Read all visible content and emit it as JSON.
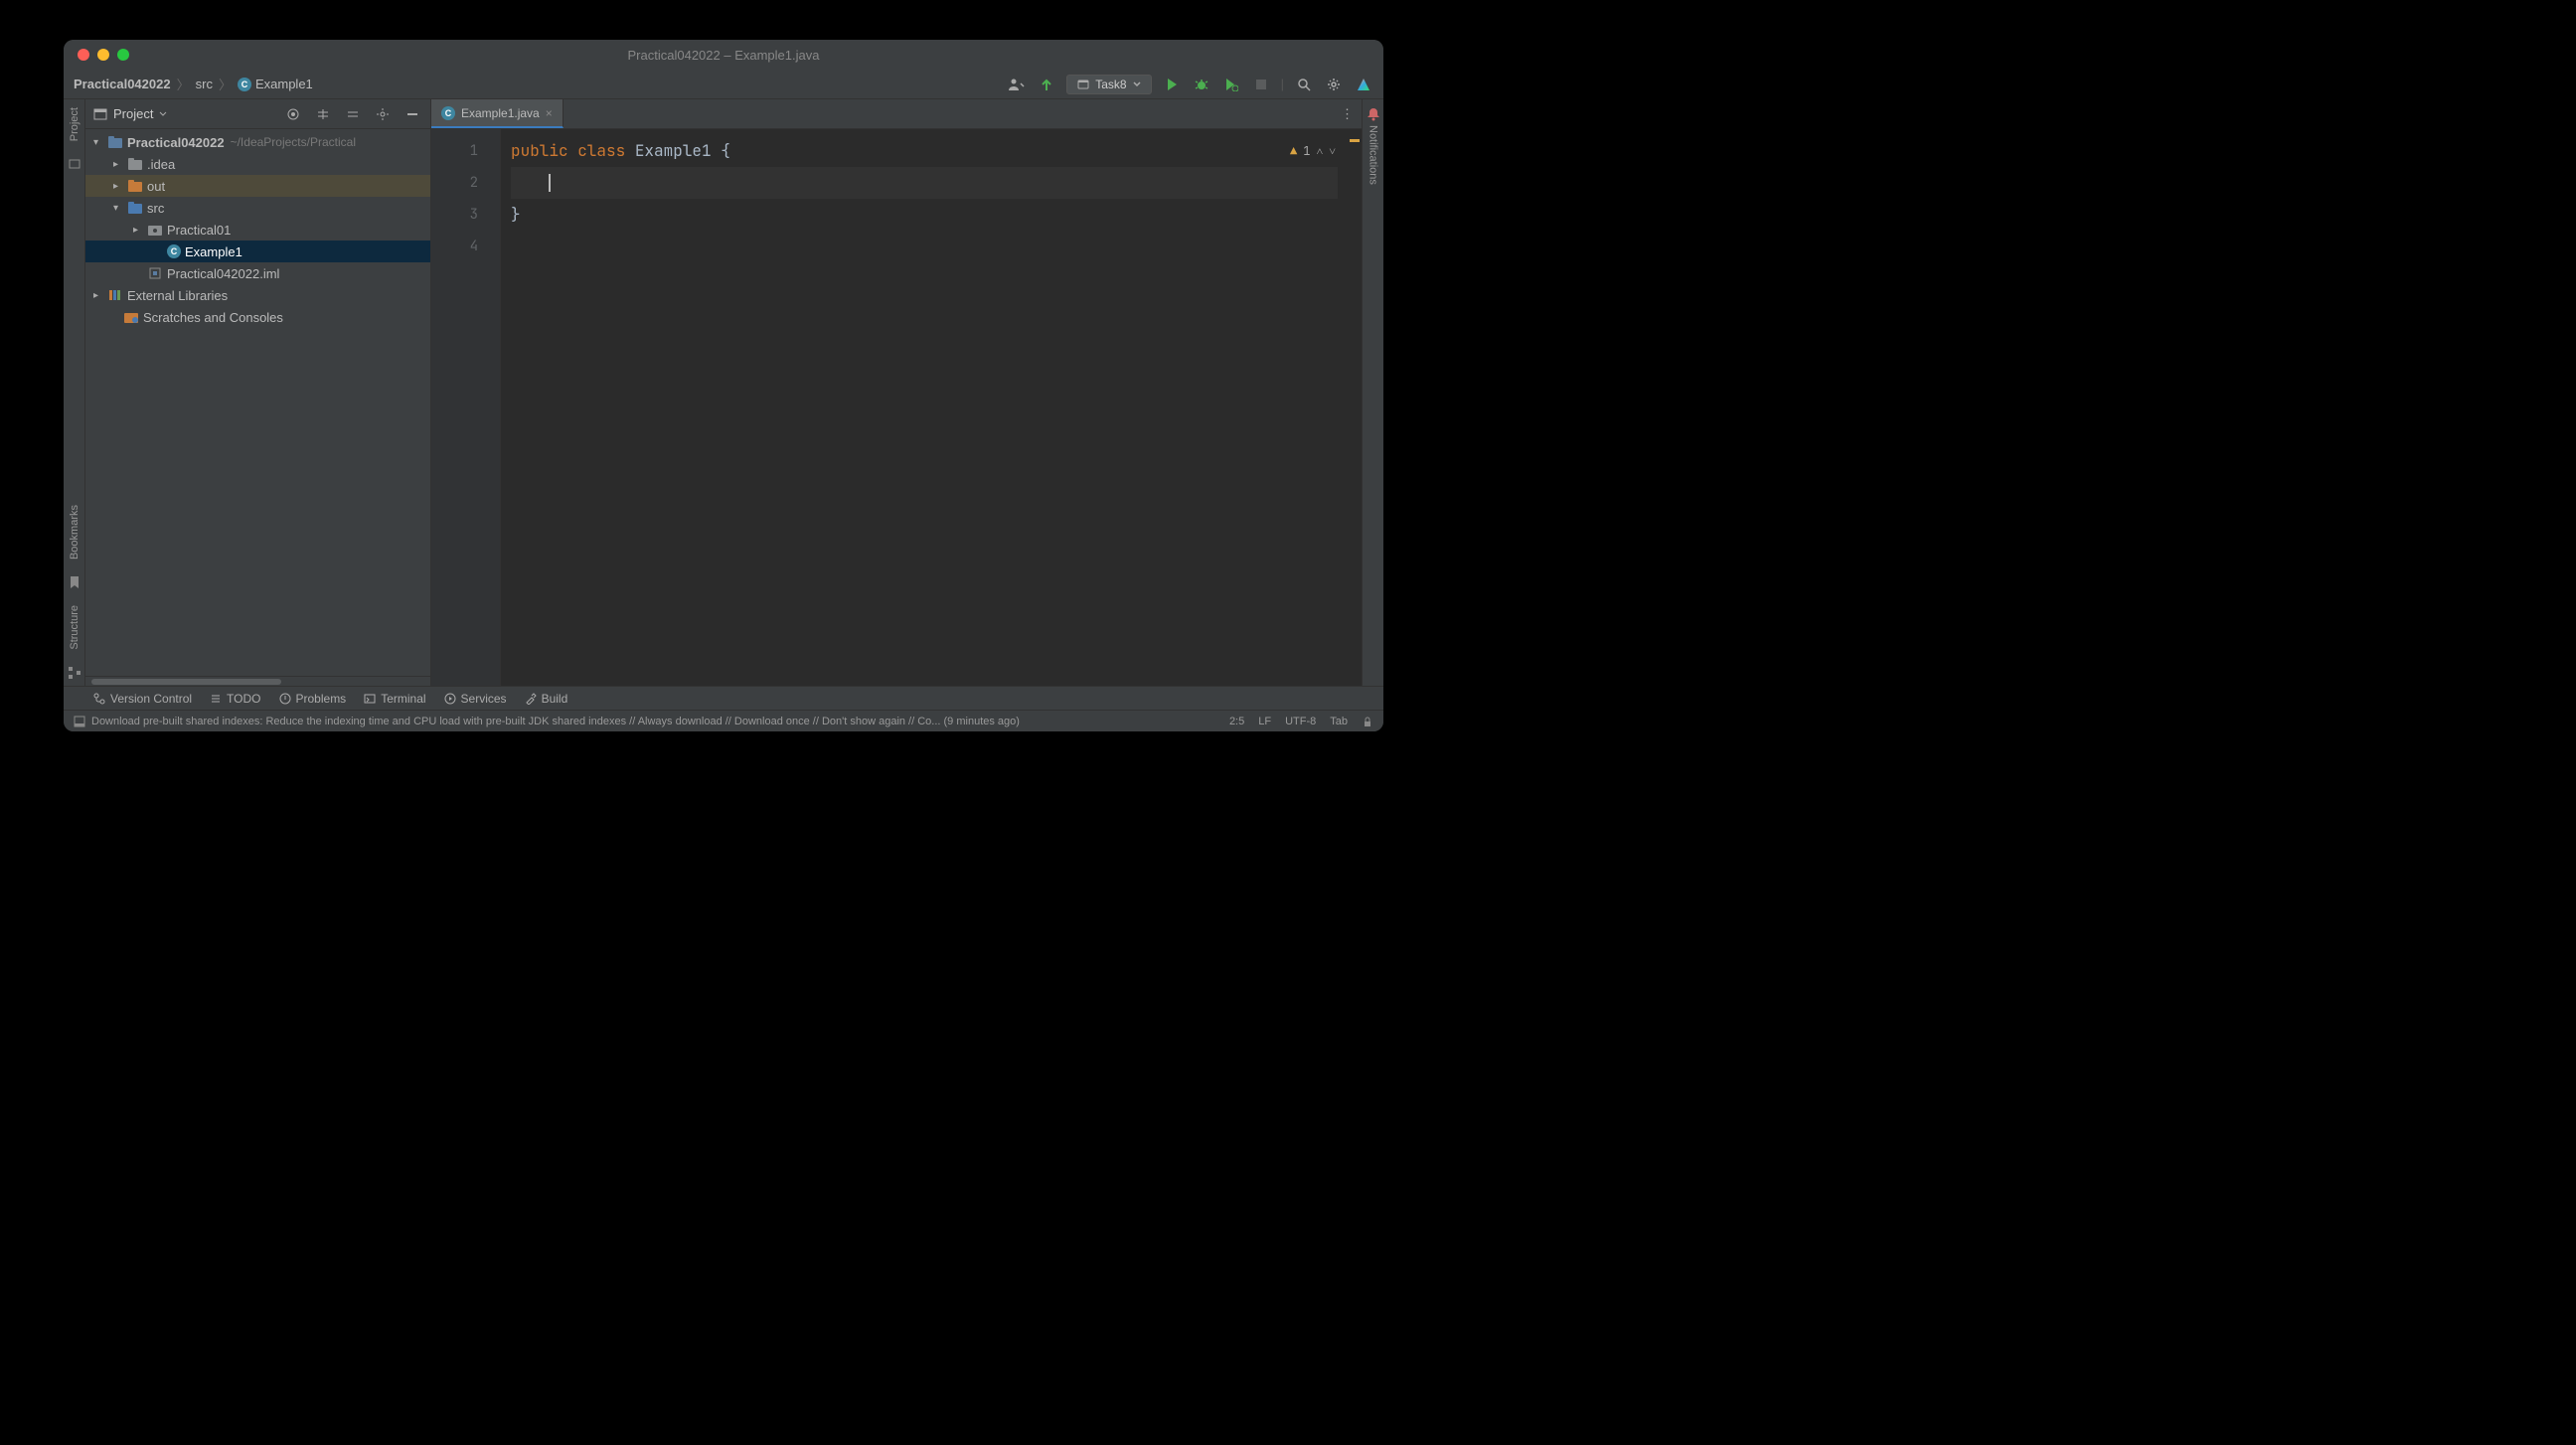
{
  "window_title": "Practical042022 – Example1.java",
  "breadcrumb": {
    "project": "Practical042022",
    "folder": "src",
    "file": "Example1"
  },
  "run_config": "Task8",
  "panel": {
    "title": "Project",
    "tree": {
      "root": {
        "name": "Practical042022",
        "path": "~/IdeaProjects/Practical"
      },
      "idea": ".idea",
      "out": "out",
      "src": "src",
      "pkg": "Practical01",
      "cls": "Example1",
      "iml": "Practical042022.iml",
      "ext": "External Libraries",
      "scratch": "Scratches and Consoles"
    }
  },
  "tab": {
    "name": "Example1.java"
  },
  "code": {
    "lines": [
      "1",
      "2",
      "3",
      "4"
    ],
    "l1_kw": "public class ",
    "l1_name": "Example1 ",
    "l1_brace": "{",
    "l3": "}",
    "indent": "    "
  },
  "inspections": {
    "count": "1"
  },
  "bottom": {
    "vcs": "Version Control",
    "todo": "TODO",
    "problems": "Problems",
    "terminal": "Terminal",
    "services": "Services",
    "build": "Build"
  },
  "status": {
    "message": "Download pre-built shared indexes: Reduce the indexing time and CPU load with pre-built JDK shared indexes // Always download // Download once // Don't show again // Co... (9 minutes ago)",
    "pos": "2:5",
    "sep": "LF",
    "enc": "UTF-8",
    "indent": "Tab"
  },
  "rails": {
    "project": "Project",
    "bookmarks": "Bookmarks",
    "structure": "Structure",
    "notifications": "Notifications"
  }
}
